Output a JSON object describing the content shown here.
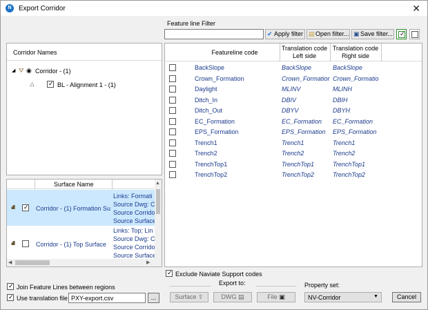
{
  "window": {
    "title": "Export Corridor",
    "app_icon_letter": "N"
  },
  "filter": {
    "label": "Feature line Filter",
    "input_value": "",
    "apply_label": "Apply filter",
    "open_label": "Open filter...",
    "save_label": "Save filter..."
  },
  "corridor_tree": {
    "header": "Corridor Names",
    "root_label": "Corridor - (1)",
    "child_label": "BL - Alignment 1 - (1)"
  },
  "surface_table": {
    "header": "Surface Name",
    "rows": [
      {
        "name": "Corridor - (1) Formation Su",
        "info": [
          "Links: Formati",
          "Source Dwg: C",
          "Source Corrido",
          "Source Surface"
        ],
        "checked": true
      },
      {
        "name": "Corridor - (1) Top Surface",
        "info": [
          "Links: Top; Lin",
          "Source Dwg: C",
          "Source Corrido",
          "Source Surface"
        ],
        "checked": false
      }
    ]
  },
  "featureline_table": {
    "headers": {
      "code": "Featureline code",
      "left_1": "Translation code",
      "left_2": "Left side",
      "right_1": "Translation code",
      "right_2": "Right side"
    },
    "rows": [
      {
        "code": "BackSlope",
        "left": "BackSlope",
        "right": "BackSlope"
      },
      {
        "code": "Crown_Formation",
        "left": "Crown_Formation",
        "right": "Crown_Formatio"
      },
      {
        "code": "Daylight",
        "left": "MLINV",
        "right": "MLINH"
      },
      {
        "code": "Ditch_In",
        "left": "DBIV",
        "right": "DBIH"
      },
      {
        "code": "Ditch_Out",
        "left": "DBYV",
        "right": "DBYH"
      },
      {
        "code": "EC_Formation",
        "left": "EC_Formation",
        "right": "EC_Formation"
      },
      {
        "code": "EPS_Formation",
        "left": "EPS_Formation",
        "right": "EPS_Formation"
      },
      {
        "code": "Trench1",
        "left": "Trench1",
        "right": "Trench1"
      },
      {
        "code": "Trench2",
        "left": "Trench2",
        "right": "Trench2"
      },
      {
        "code": "TrenchTop1",
        "left": "TrenchTop1",
        "right": "TrenchTop1"
      },
      {
        "code": "TrenchTop2",
        "left": "TrenchTop2",
        "right": "TrenchTop2"
      }
    ]
  },
  "options": {
    "exclude_label": "Exclude Naviate Support codes",
    "join_label": "Join Feature Lines between regions",
    "use_translation_label": "Use translation file",
    "translation_file": "PXY-export.csv",
    "browse_label": "..."
  },
  "export": {
    "label": "Export to:",
    "surface_label": "Surface",
    "dwg_label": "DWG",
    "file_label": "File"
  },
  "property_set": {
    "label": "Property set:",
    "value": "NV-Corridor"
  },
  "cancel_label": "Cancel",
  "colors": {
    "link_text": "#1a3a8c",
    "selection": "#cce8ff",
    "app_icon": "#1e73c8"
  }
}
